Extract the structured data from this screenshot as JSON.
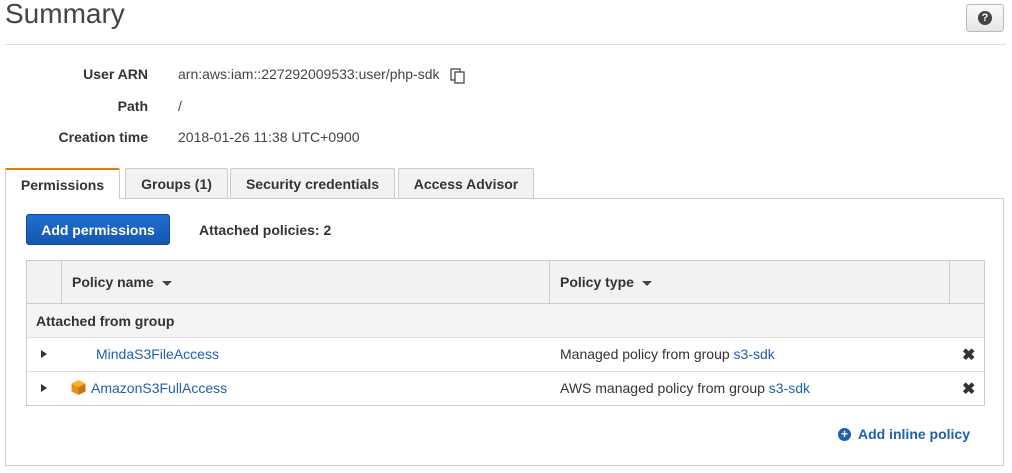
{
  "header": {
    "title": "Summary",
    "help_icon": "question-mark-icon"
  },
  "summary": {
    "user_arn_label": "User ARN",
    "user_arn_value": "arn:aws:iam::227292009533:user/php-sdk",
    "path_label": "Path",
    "path_value": "/",
    "creation_label": "Creation time",
    "creation_value": "2018-01-26 11:38 UTC+0900"
  },
  "tabs": [
    {
      "label": "Permissions",
      "active": true
    },
    {
      "label": "Groups (1)",
      "active": false
    },
    {
      "label": "Security credentials",
      "active": false
    },
    {
      "label": "Access Advisor",
      "active": false
    }
  ],
  "permissions": {
    "add_button": "Add permissions",
    "attached_count": "Attached policies: 2",
    "columns": [
      "Policy name",
      "Policy type"
    ],
    "group_header": "Attached from group",
    "rows": [
      {
        "name": "MindaS3FileAccess",
        "type_prefix": "Managed policy from group ",
        "group": "s3-sdk",
        "icon": ""
      },
      {
        "name": "AmazonS3FullAccess",
        "type_prefix": "AWS managed policy from group ",
        "group": "s3-sdk",
        "icon": "aws-cube-icon"
      }
    ],
    "add_inline": "Add inline policy"
  },
  "colors": {
    "accent": "#e47911",
    "primary": "#1557b0",
    "link": "#1f5fb0"
  }
}
